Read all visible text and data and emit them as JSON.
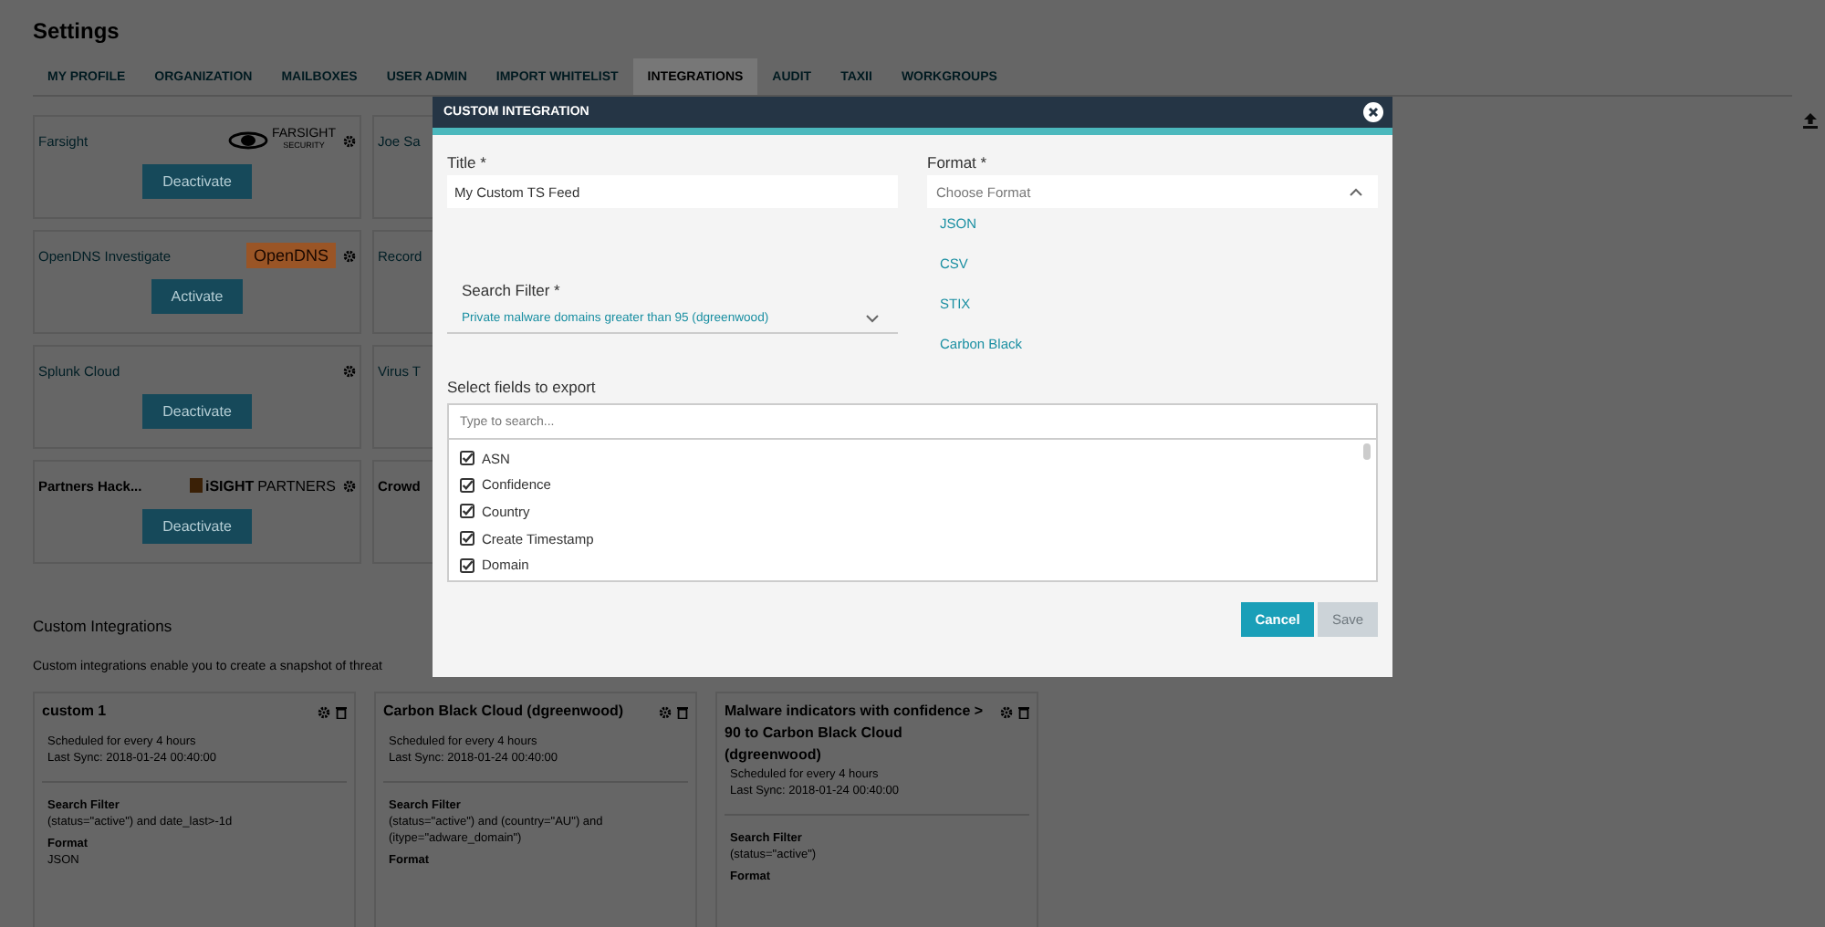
{
  "page": {
    "title": "Settings"
  },
  "tabs": [
    {
      "label": "MY PROFILE",
      "selected": false
    },
    {
      "label": "ORGANIZATION",
      "selected": false
    },
    {
      "label": "MAILBOXES",
      "selected": false
    },
    {
      "label": "USER ADMIN",
      "selected": false
    },
    {
      "label": "IMPORT WHITELIST",
      "selected": false
    },
    {
      "label": "INTEGRATIONS",
      "selected": true
    },
    {
      "label": "AUDIT",
      "selected": false
    },
    {
      "label": "TAXII",
      "selected": false
    },
    {
      "label": "WORKGROUPS",
      "selected": false
    }
  ],
  "integrations": [
    {
      "name": "Farsight",
      "kind": "farsight",
      "logo_text": [
        "FARSIGHT",
        "SECURITY"
      ],
      "button": "Deactivate",
      "partner": false
    },
    {
      "name": "Joe Sa",
      "kind": "plain",
      "partner": false
    },
    {
      "name": "OpenDNS Investigate",
      "kind": "opendns",
      "logo_text": [
        "OpenDNS"
      ],
      "button": "Activate",
      "partner": false
    },
    {
      "name": "Record",
      "kind": "plain",
      "partner": false
    },
    {
      "name": "Splunk Cloud",
      "kind": "plain",
      "button": "Deactivate",
      "partner": false
    },
    {
      "name": "Virus T",
      "kind": "plain",
      "partner": false
    },
    {
      "name": "Partners Hack...",
      "kind": "isight",
      "logo_text": [
        "iSIGHT",
        "PARTNERS"
      ],
      "button": "Deactivate",
      "partner": true
    },
    {
      "name": "Crowd",
      "kind": "plain",
      "partner": true
    }
  ],
  "custom": {
    "heading": "Custom Integrations",
    "description": "Custom integrations enable you to create a snapshot of threat",
    "cards": [
      {
        "title": "custom 1",
        "schedule": "Scheduled for every 4 hours",
        "last_sync": "Last Sync: 2018-01-24 00:40:00",
        "filter_label": "Search Filter",
        "filter": "(status=\"active\") and date_last>-1d",
        "format_label": "Format",
        "format": "JSON"
      },
      {
        "title": "Carbon Black Cloud (dgreenwood)",
        "schedule": "Scheduled for every 4 hours",
        "last_sync": "Last Sync: 2018-01-24 00:40:00",
        "filter_label": "Search Filter",
        "filter": "(status=\"active\") and (country=\"AU\") and (itype=\"adware_domain\")",
        "format_label": "Format"
      },
      {
        "title": "Malware indicators with confidence > 90 to Carbon Black Cloud (dgreenwood)",
        "schedule": "Scheduled for every 4 hours",
        "last_sync": "Last Sync: 2018-01-24 00:40:00",
        "filter_label": "Search Filter",
        "filter": "(status=\"active\")",
        "format_label": "Format"
      }
    ]
  },
  "modal": {
    "title": "CUSTOM INTEGRATION",
    "title_label": "Title *",
    "title_value": "My Custom TS Feed",
    "format_label": "Format *",
    "format_placeholder": "Choose Format",
    "format_expanded": true,
    "format_options": [
      "JSON",
      "CSV",
      "STIX",
      "Carbon Black"
    ],
    "filter_label": "Search Filter *",
    "filter_value": "Private malware domains greater than 95 (dgreenwood)",
    "fields_label": "Select fields to export",
    "fields_placeholder": "Type to search...",
    "fields": [
      {
        "label": "ASN",
        "checked": true
      },
      {
        "label": "Confidence",
        "checked": true
      },
      {
        "label": "Country",
        "checked": true
      },
      {
        "label": "Create Timestamp",
        "checked": true
      },
      {
        "label": "Domain",
        "checked": true
      }
    ],
    "cancel": "Cancel",
    "save": {
      "label": "Save",
      "disabled": true
    }
  }
}
